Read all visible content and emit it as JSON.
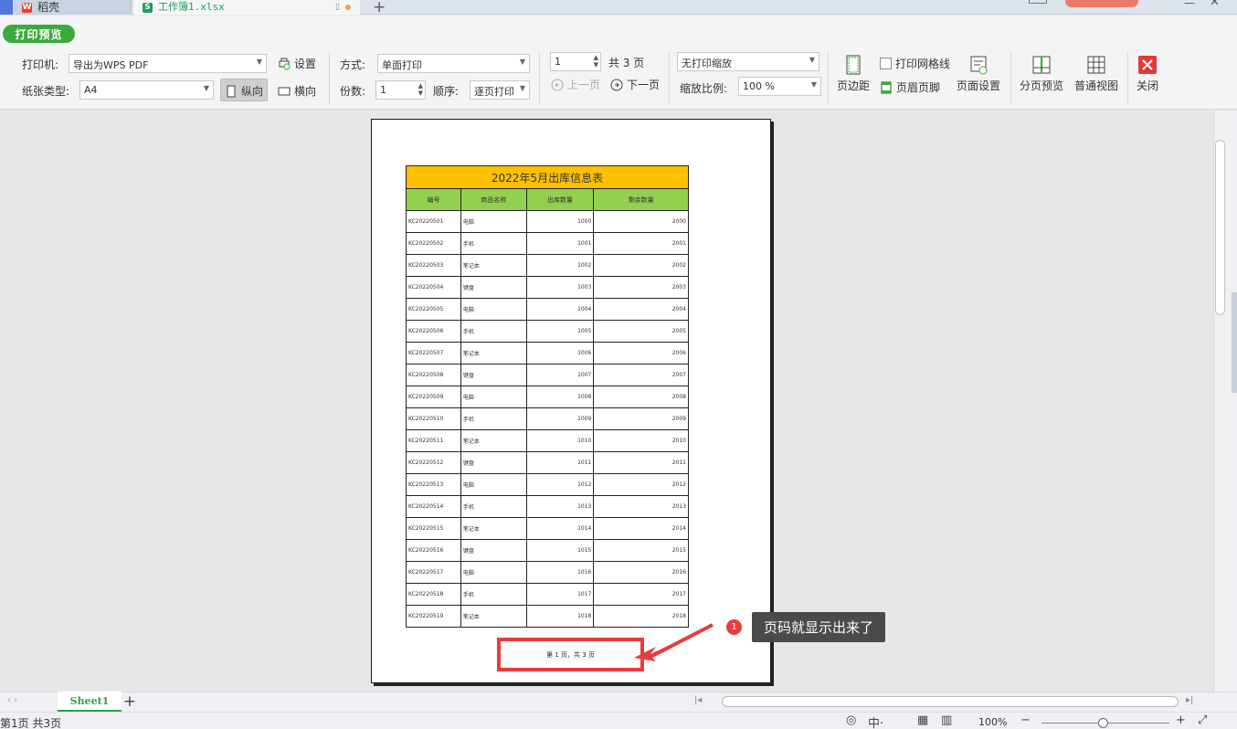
{
  "tabs": {
    "tab1_label": "稻壳",
    "tab2_label": "工作簿1.xlsx",
    "new_tab": "+"
  },
  "toolbar": {
    "print_preview": "打印预览",
    "printer_label": "打印机:",
    "printer_value": "导出为WPS PDF",
    "settings": "设置",
    "paper_label": "纸张类型:",
    "paper_value": "A4",
    "portrait": "纵向",
    "landscape": "横向",
    "mode_label": "方式:",
    "mode_value": "单面打印",
    "copies_label": "份数:",
    "copies_value": "1",
    "order_label": "顺序:",
    "order_value": "逐页打印",
    "page_value": "1",
    "total_pages": "共 3 页",
    "prev_page": "上一页",
    "next_page": "下一页",
    "scale_value": "无打印缩放",
    "zoom_label": "缩放比例:",
    "zoom_value": "100 %",
    "margins": "页边距",
    "print_gridlines": "打印网格线",
    "header_footer": "页眉页脚",
    "page_setup": "页面设置",
    "page_break_preview": "分页预览",
    "normal_view": "普通视图",
    "close": "关闭"
  },
  "sheet": {
    "title": "2022年5月出库信息表",
    "headers": [
      "编号",
      "商品名称",
      "出库数量",
      "剩余数量"
    ],
    "rows": [
      [
        "KC20220501",
        "电脑",
        "1000",
        "2000"
      ],
      [
        "KC20220502",
        "手机",
        "1001",
        "2001"
      ],
      [
        "KC20220503",
        "笔记本",
        "1002",
        "2002"
      ],
      [
        "KC20220504",
        "键盘",
        "1003",
        "2003"
      ],
      [
        "KC20220505",
        "电脑",
        "1004",
        "2004"
      ],
      [
        "KC20220506",
        "手机",
        "1005",
        "2005"
      ],
      [
        "KC20220507",
        "笔记本",
        "1006",
        "2006"
      ],
      [
        "KC20220508",
        "键盘",
        "1007",
        "2007"
      ],
      [
        "KC20220509",
        "电脑",
        "1008",
        "2008"
      ],
      [
        "KC20220510",
        "手机",
        "1009",
        "2009"
      ],
      [
        "KC20220511",
        "笔记本",
        "1010",
        "2010"
      ],
      [
        "KC20220512",
        "键盘",
        "1011",
        "2011"
      ],
      [
        "KC20220513",
        "电脑",
        "1012",
        "2012"
      ],
      [
        "KC20220514",
        "手机",
        "1013",
        "2013"
      ],
      [
        "KC20220515",
        "笔记本",
        "1014",
        "2014"
      ],
      [
        "KC20220516",
        "键盘",
        "1015",
        "2015"
      ],
      [
        "KC20220517",
        "电脑",
        "1016",
        "2016"
      ],
      [
        "KC20220518",
        "手机",
        "1017",
        "2017"
      ],
      [
        "KC20220519",
        "笔记本",
        "1018",
        "2018"
      ]
    ],
    "footer": "第 1 页，共 3 页"
  },
  "callout": {
    "badge": "1",
    "text": "页码就显示出来了"
  },
  "sheet_tabs": {
    "active": "Sheet1",
    "add": "+"
  },
  "status": {
    "page_info": "第1页 共3页",
    "zoom": "100%"
  },
  "colors": {
    "accent_green": "#3aaa3f",
    "title_fill": "#ffc000",
    "header_fill": "#92d050",
    "highlight_red": "#e93b3b"
  }
}
